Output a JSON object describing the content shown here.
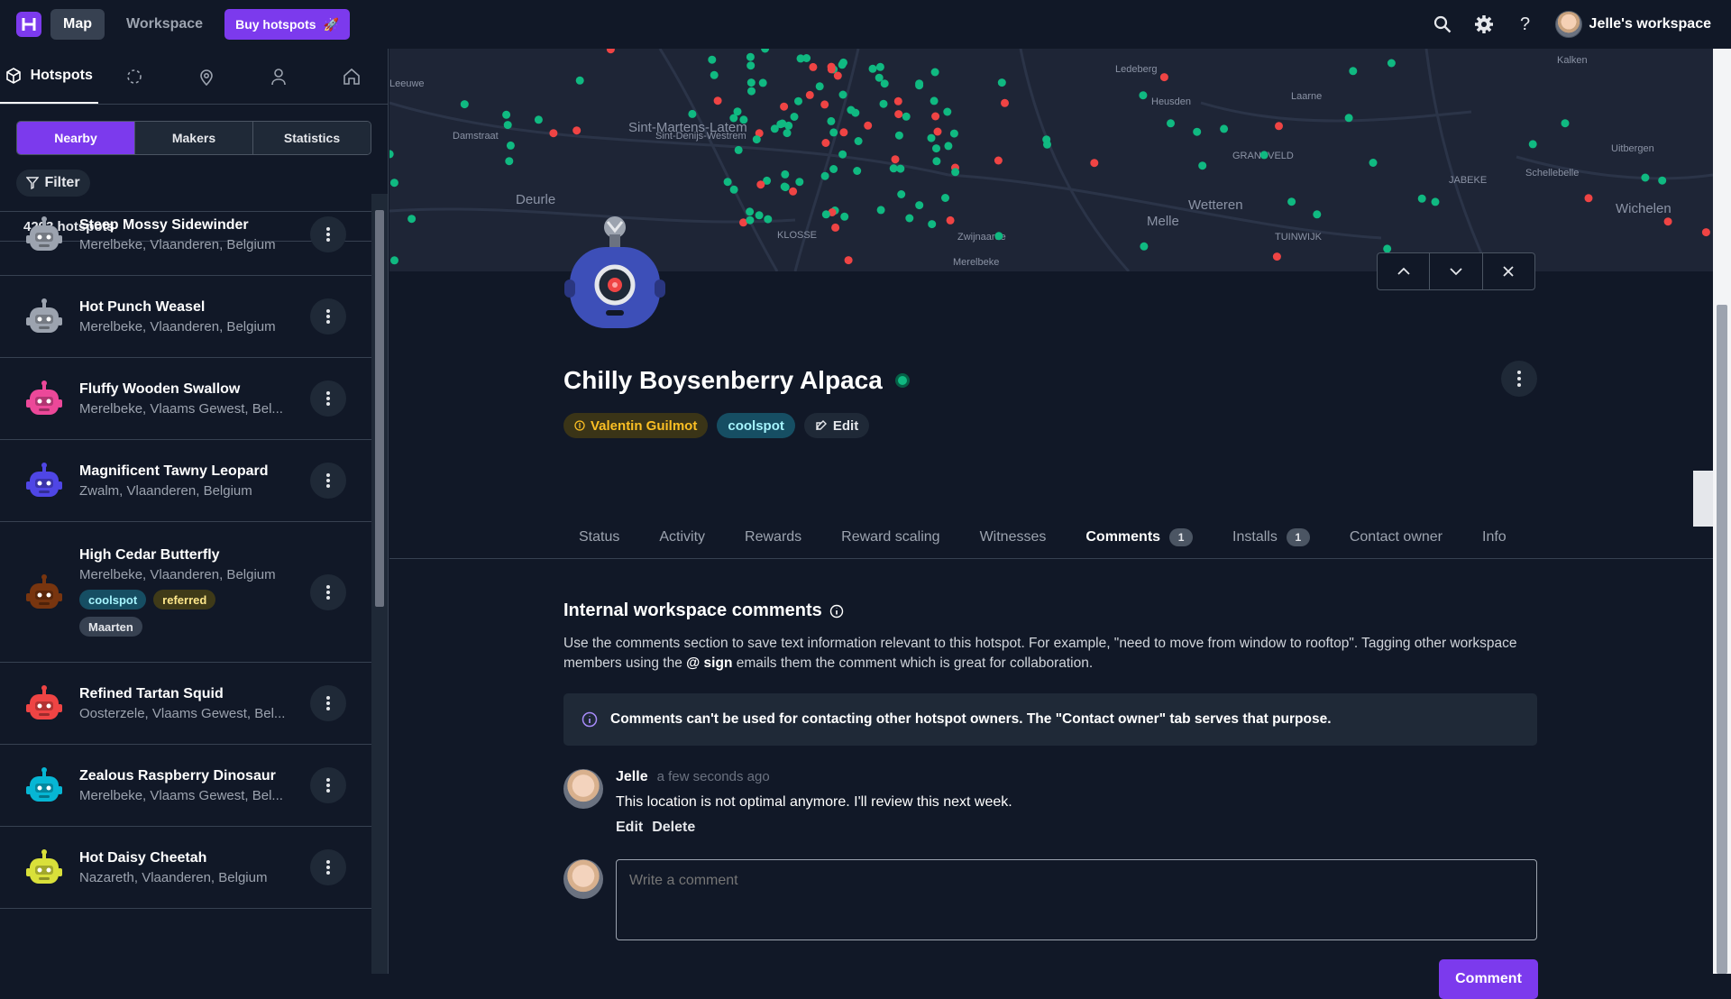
{
  "topbar": {
    "nav": [
      {
        "label": "Map",
        "active": true
      },
      {
        "label": "Workspace",
        "active": false
      }
    ],
    "buy_label": "Buy hotspots",
    "workspace_label": "Jelle's workspace"
  },
  "left": {
    "tabs": [
      {
        "label": "Hotspots",
        "icon": "cube-icon"
      },
      {
        "icon": "loading-icon"
      },
      {
        "icon": "location-pin-icon"
      },
      {
        "icon": "user-icon"
      },
      {
        "icon": "home-icon"
      }
    ],
    "segments": [
      "Nearby",
      "Makers",
      "Statistics"
    ],
    "filter_label": "Filter",
    "count_label": "4293 hotspots",
    "items": [
      {
        "name": "Steep Mossy Sidewinder",
        "location": "Merelbeke, Vlaanderen, Belgium",
        "color": "#9ca3af"
      },
      {
        "name": "Hot Punch Weasel",
        "location": "Merelbeke, Vlaanderen, Belgium",
        "color": "#9ca3af"
      },
      {
        "name": "Fluffy Wooden Swallow",
        "location": "Merelbeke, Vlaams Gewest, Bel...",
        "color": "#ec4899"
      },
      {
        "name": "Magnificent Tawny Leopard",
        "location": "Zwalm, Vlaanderen, Belgium",
        "color": "#4f46e5"
      },
      {
        "name": "High Cedar Butterfly",
        "location": "Merelbeke, Vlaanderen, Belgium",
        "color": "#78350f",
        "tags": [
          "coolspot",
          "referred",
          "Maarten"
        ]
      },
      {
        "name": "Refined Tartan Squid",
        "location": "Oosterzele, Vlaams Gewest, Bel...",
        "color": "#ef4444"
      },
      {
        "name": "Zealous Raspberry Dinosaur",
        "location": "Merelbeke, Vlaams Gewest, Bel...",
        "color": "#06b6d4"
      },
      {
        "name": "Hot Daisy Cheetah",
        "location": "Nazareth, Vlaanderen, Belgium",
        "color": "#d9e03a"
      }
    ]
  },
  "map": {
    "labels": [
      "Sint-Martens-Latem",
      "Deurle",
      "Damstraat",
      "Leeuwe",
      "Sint-Denijs-Westrem",
      "Heusden",
      "Melle",
      "Merelbeke",
      "Wetteren",
      "Wichelen",
      "GRANSVELD",
      "JABEKE",
      "Schellebelle",
      "Uitbergen",
      "Kalken",
      "Laarne",
      "Zwijnaarde",
      "KLOSSE",
      "TUINWIJK",
      "Ledeberg"
    ],
    "colors": {
      "green": "#10b981",
      "red": "#ef4444"
    }
  },
  "hotspot": {
    "name": "Chilly Boysenberry Alpaca",
    "status_color": "#10b981",
    "owner_chip": "Valentin Guilmot",
    "tag_chip": "coolspot",
    "edit_label": "Edit"
  },
  "tabs": [
    {
      "label": "Status"
    },
    {
      "label": "Activity"
    },
    {
      "label": "Rewards"
    },
    {
      "label": "Reward scaling"
    },
    {
      "label": "Witnesses"
    },
    {
      "label": "Comments",
      "badge": "1",
      "active": true
    },
    {
      "label": "Installs",
      "badge": "1"
    },
    {
      "label": "Contact owner"
    },
    {
      "label": "Info"
    }
  ],
  "comments": {
    "heading": "Internal workspace comments",
    "desc_pre": "Use the comments section to save text information relevant to this hotspot. For example, \"need to move from window to rooftop\". Tagging other workspace members using the ",
    "desc_bold": "@ sign",
    "desc_post": " emails them the comment which is great for collaboration.",
    "notice": "Comments can't be used for contacting other hotspot owners. The \"Contact owner\" tab serves that purpose.",
    "items": [
      {
        "author": "Jelle",
        "time": "a few seconds ago",
        "text": "This location is not optimal anymore. I'll review this next week.",
        "edit_label": "Edit",
        "delete_label": "Delete"
      }
    ],
    "placeholder": "Write a comment",
    "button_label": "Comment"
  }
}
